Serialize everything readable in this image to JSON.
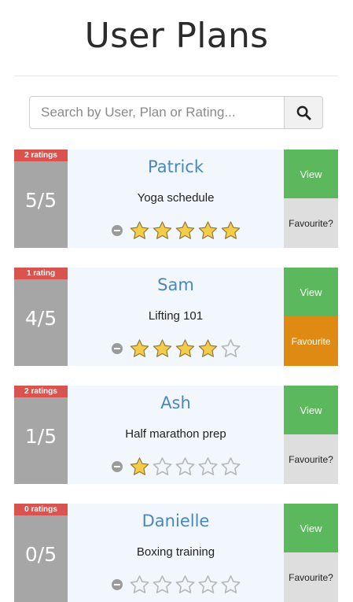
{
  "page": {
    "title": "User Plans"
  },
  "search": {
    "placeholder": "Search by User, Plan or Rating...",
    "icon": "search-icon"
  },
  "plans": [
    {
      "ratings_label": "2 ratings",
      "score": "5/5",
      "stars": 5,
      "name": "Patrick",
      "plan": "Yoga schedule",
      "view_label": "View",
      "favourite_label": "Favourite?",
      "favourited": false
    },
    {
      "ratings_label": "1 rating",
      "score": "4/5",
      "stars": 4,
      "name": "Sam",
      "plan": "Lifting 101",
      "view_label": "View",
      "favourite_label": "Favourite",
      "favourited": true
    },
    {
      "ratings_label": "2 ratings",
      "score": "1/5",
      "stars": 1,
      "name": "Ash",
      "plan": "Half marathon prep",
      "view_label": "View",
      "favourite_label": "Favourite?",
      "favourited": false
    },
    {
      "ratings_label": "0 ratings",
      "score": "0/5",
      "stars": 0,
      "name": "Danielle",
      "plan": "Boxing training",
      "view_label": "View",
      "favourite_label": "Favourite?",
      "favourited": false
    }
  ],
  "colors": {
    "ratings_badge": "#d9534f",
    "score_panel": "#a6a6a6",
    "name_text": "#4a87bf",
    "view_button": "#5cb85c",
    "favourite_active": "#df8a13",
    "favourite_inactive": "#dedede",
    "star_filled": "#f5cc4a",
    "star_empty": "#b8b8b8"
  }
}
